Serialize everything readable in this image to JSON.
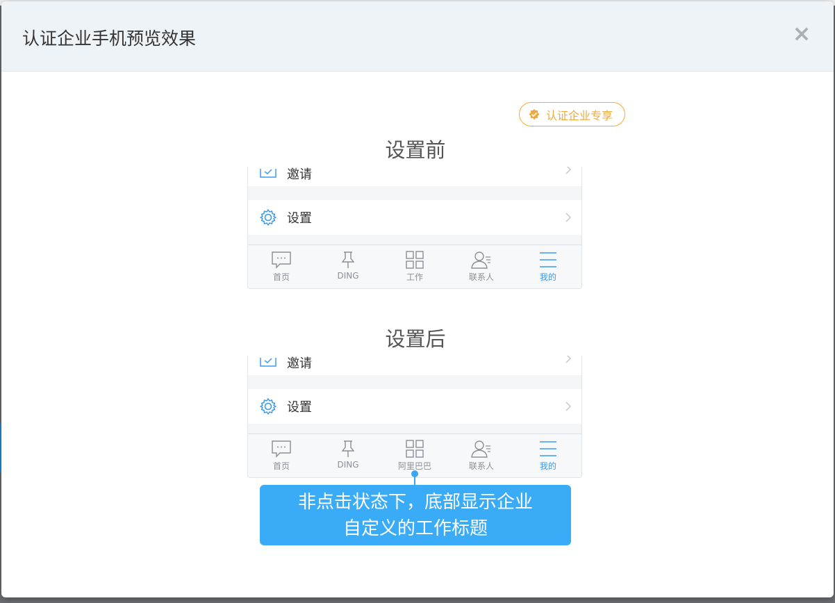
{
  "modal": {
    "title": "认证企业手机预览效果",
    "close_label": "×"
  },
  "badge": {
    "label": "认证企业专享",
    "icon": "verified-check-icon",
    "color": "#f2a93b"
  },
  "before": {
    "title": "设置前",
    "partial_row_label": "邀请",
    "settings_row_label": "设置",
    "tabs": [
      {
        "label": "首页",
        "icon": "message-icon",
        "active": false
      },
      {
        "label": "DING",
        "icon": "pin-icon",
        "active": false
      },
      {
        "label": "工作",
        "icon": "grid-icon",
        "active": false
      },
      {
        "label": "联系人",
        "icon": "contacts-icon",
        "active": false
      },
      {
        "label": "我的",
        "icon": "menu-icon",
        "active": true
      }
    ]
  },
  "after": {
    "title": "设置后",
    "partial_row_label": "邀请",
    "settings_row_label": "设置",
    "tabs": [
      {
        "label": "首页",
        "icon": "message-icon",
        "active": false
      },
      {
        "label": "DING",
        "icon": "pin-icon",
        "active": false
      },
      {
        "label": "阿里巴巴",
        "icon": "grid-icon",
        "active": false
      },
      {
        "label": "联系人",
        "icon": "contacts-icon",
        "active": false
      },
      {
        "label": "我的",
        "icon": "menu-icon",
        "active": true
      }
    ]
  },
  "tooltip": {
    "line1": "非点击状态下，底部显示企业",
    "line2": "自定义的工作标题",
    "color": "#3aabf6"
  },
  "colors": {
    "accent": "#3a9bea",
    "tab_inactive": "#8a8f96"
  }
}
